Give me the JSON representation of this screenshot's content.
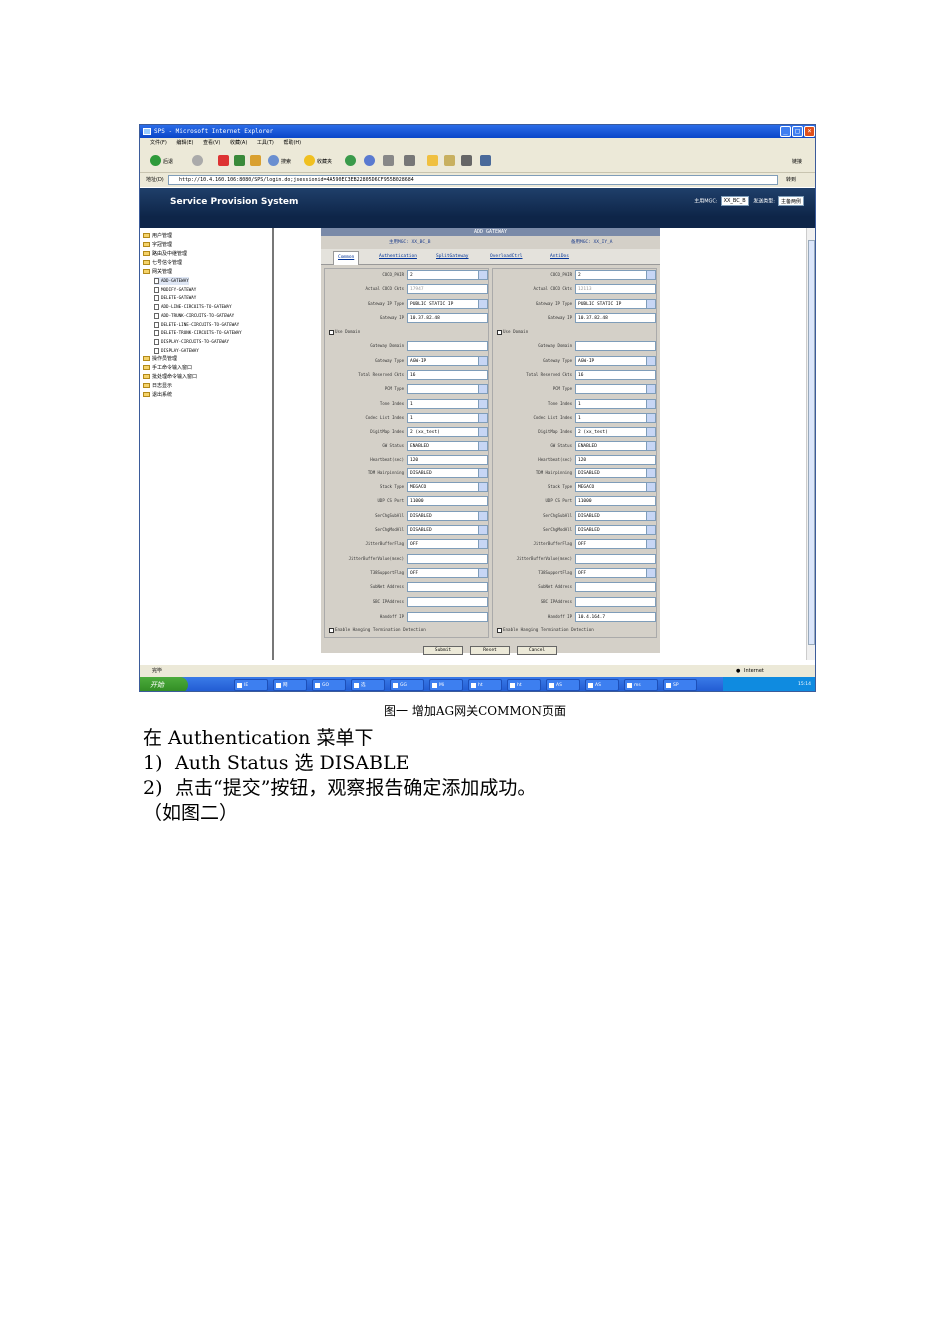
{
  "window": {
    "title": "SPS - Microsoft Internet Explorer"
  },
  "menu": [
    "文件(F)",
    "编辑(E)",
    "查看(V)",
    "收藏(A)",
    "工具(T)",
    "帮助(H)"
  ],
  "toolbar": {
    "back": "后退",
    "search": "搜索",
    "favorites": "收藏夹",
    "links": "链接"
  },
  "address": {
    "label": "地址(D)",
    "url": "http://10.4.160.106:8080/SPS/login.do;jsessionid=4A590EC3EB22805D6CF955B028684",
    "go": "转到"
  },
  "app": {
    "title": "Service Provision System",
    "main_mgc_label": "主用MGC:",
    "main_mgc_value": "XX_BC_B",
    "send_type_label": "发送类型:",
    "send_type_value": "主备两例"
  },
  "tree": {
    "items": [
      "用户管理",
      "字冠管理",
      "路由及中继管理",
      "七号信令管理",
      "网关管理"
    ],
    "gateway_children": [
      "ADD-GATEWAY",
      "MODIFY-GATEWAY",
      "DELETE-GATEWAY",
      "ADD-LINE-CIRCUITS-TO-GATEWAY",
      "ADD-TRUNK-CIRCUITS-TO-GATEWAY",
      "DELETE-LINE-CIRCUITS-TO-GATEWAY",
      "DELETE-TRUNK-CIRCUITS-TO-GATEWAY",
      "DISPLAY-CIRCUITS-TO-GATEWAY",
      "DISPLAY-GATEWAY"
    ],
    "items_after": [
      "操作员管理",
      "手工命令输入窗口",
      "批处理命令输入窗口",
      "日志显示",
      "退出系统"
    ]
  },
  "form": {
    "title": "ADD GATEWAY",
    "main_mgc": "主用MGC: XX_BC_B",
    "backup_mgc": "备用MGC: XX_IY_A",
    "tabs": [
      "Common",
      "Authentication",
      "SplitGateway",
      "OverloadCtrl",
      "AntiDos"
    ],
    "labels": [
      "COCO_PAIR",
      "Actual COCO Ckts",
      "Gateway IP Type",
      "Gateway IP",
      "Gateway Domain",
      "Gateway Type",
      "Total Reserved Ckts",
      "PCM Type",
      "Tone Index",
      "Codec List Index",
      "DigitMap Index",
      "GW Status",
      "Heartbeat(sec)",
      "TDM Hairpinning",
      "Stack Type",
      "UDP CS Port",
      "SerChgSubAll",
      "SerChgModAll",
      "JitterBufferFlag",
      "JitterBufferValue(msec)",
      "T38SupportFlag",
      "SubNet Address",
      "SBC IPAddress",
      "Handoff IP"
    ],
    "use_domain": "Use Domain",
    "enable_hanging": "Enable Hanging Termination Detection",
    "left": [
      "2",
      "17947",
      "PUBLIC STATIC IP",
      "10.37.82.48",
      "",
      "AGW-IP",
      "16",
      "",
      "1",
      "1",
      "2 (xx_test)",
      "ENABLED",
      "120",
      "DISABLED",
      "MEGACO",
      "11000",
      "DISABLED",
      "DISABLED",
      "OFF",
      "",
      "OFF",
      "",
      "",
      ""
    ],
    "right": [
      "2",
      "12113",
      "PUBLIC STATIC IP",
      "10.37.82.48",
      "",
      "AGW-IP",
      "16",
      "",
      "1",
      "1",
      "2 (xx_test)",
      "ENABLED",
      "120",
      "DISABLED",
      "MEGACO",
      "11000",
      "DISABLED",
      "DISABLED",
      "OFF",
      "",
      "OFF",
      "",
      "",
      "10.4.164.7"
    ],
    "buttons": [
      "Submit",
      "Reset",
      "Cancel"
    ]
  },
  "statusbar": {
    "text": "完毕",
    "zone": "Internet"
  },
  "taskbar": {
    "start": "开始",
    "tasks": [
      "IE",
      "网",
      "GO",
      "选",
      "GG",
      "Mi",
      "ht",
      "ht",
      "AS",
      "AS",
      "ms",
      "SP"
    ],
    "clock": "15:14"
  },
  "caption": "图一 增加AG网关COMMON页面",
  "text": {
    "line1": "在 Authentication 菜单下",
    "step1_num": "1)",
    "step1": "Auth Status 选 DISABLE",
    "step2_num": "2)",
    "step2": "点击“提交”按钮，观察报告确定添加成功。",
    "line4": "（如图二）"
  },
  "colors": {
    "titlebar": "#0a46c8",
    "header": "#1f3f6a",
    "form_bg": "#d4d0c8",
    "taskbar": "#1f58d0",
    "start": "#2f8a22"
  },
  "icons": [
    "ie-icon",
    "back-icon",
    "forward-icon",
    "stop-icon",
    "refresh-icon",
    "home-icon",
    "search-icon",
    "favorites-icon",
    "history-icon",
    "mail-icon",
    "print-icon",
    "folder-icon",
    "document-icon",
    "globe-icon"
  ]
}
